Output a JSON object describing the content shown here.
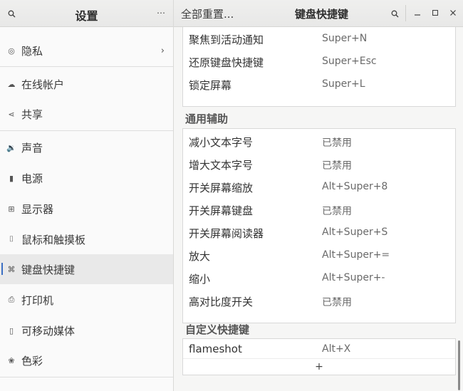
{
  "sidebar_header": {
    "title": "设置",
    "search_icon": "search-icon",
    "menu_icon": "menu-icon"
  },
  "main_header": {
    "reset_label": "全部重置...",
    "title": "键盘快捷键",
    "search_icon": "search-icon",
    "minimize_icon": "minimize-icon",
    "maximize_icon": "maximize-icon",
    "close_icon": "close-icon"
  },
  "sidebar": {
    "items": [
      {
        "label": "隐私",
        "icon": "privacy-icon",
        "chevron": "›"
      },
      {
        "label": "在线帐户",
        "icon": "cloud-icon"
      },
      {
        "label": "共享",
        "icon": "share-icon"
      },
      {
        "label": "声音",
        "icon": "sound-icon"
      },
      {
        "label": "电源",
        "icon": "power-icon"
      },
      {
        "label": "显示器",
        "icon": "display-icon"
      },
      {
        "label": "鼠标和触摸板",
        "icon": "mouse-icon"
      },
      {
        "label": "键盘快捷键",
        "icon": "keyboard-shortcut-icon",
        "active": true
      },
      {
        "label": "打印机",
        "icon": "printer-icon"
      },
      {
        "label": "可移动媒体",
        "icon": "removable-media-icon"
      },
      {
        "label": "色彩",
        "icon": "color-icon"
      }
    ]
  },
  "main": {
    "group1": {
      "rows": [
        {
          "name": "聚焦到活动通知",
          "accel": "Super+N"
        },
        {
          "name": "还原键盘快捷键",
          "accel": "Super+Esc"
        },
        {
          "name": "锁定屏幕",
          "accel": "Super+L"
        }
      ]
    },
    "accessibility": {
      "title": "通用辅助",
      "rows": [
        {
          "name": "减小文本字号",
          "accel": "已禁用"
        },
        {
          "name": "增大文本字号",
          "accel": "已禁用"
        },
        {
          "name": "开关屏幕缩放",
          "accel": "Alt+Super+8"
        },
        {
          "name": "开关屏幕键盘",
          "accel": "已禁用"
        },
        {
          "name": "开关屏幕阅读器",
          "accel": "Alt+Super+S"
        },
        {
          "name": "放大",
          "accel": "Alt+Super+="
        },
        {
          "name": "缩小",
          "accel": "Alt+Super+-"
        },
        {
          "name": "高对比度开关",
          "accel": "已禁用"
        }
      ]
    },
    "custom": {
      "title": "自定义快捷键",
      "rows": [
        {
          "name": "flameshot",
          "accel": "Alt+X"
        }
      ],
      "add_label": "+"
    }
  }
}
